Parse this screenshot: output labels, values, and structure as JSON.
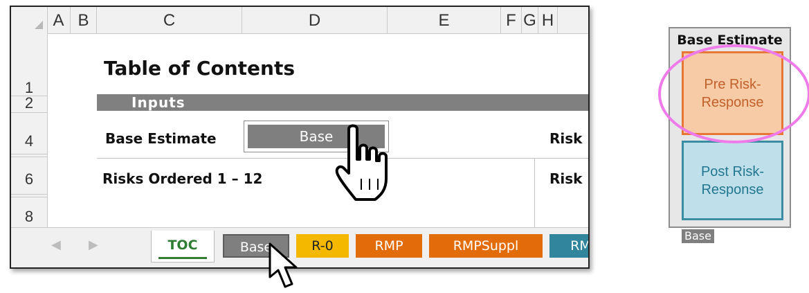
{
  "spreadsheet": {
    "columns": [
      "A",
      "B",
      "C",
      "D",
      "E",
      "F",
      "G",
      "H"
    ],
    "rows": [
      "1",
      "2",
      "4",
      "6",
      "8"
    ],
    "title": "Table of Contents",
    "section_header": "Inputs",
    "base_estimate_label": "Base Estimate",
    "base_button_label": "Base",
    "risk_label_1": "Risk",
    "risks_ordered_label": "Risks Ordered  1 – 12",
    "risk_label_2": "Risk"
  },
  "tabs": [
    {
      "label": "TOC",
      "color": "#ffffff",
      "active": true
    },
    {
      "label": "Base",
      "color": "#7f7f7f"
    },
    {
      "label": "R-0",
      "color": "#f5b800"
    },
    {
      "label": "RMP",
      "color": "#e36c0a"
    },
    {
      "label": "RMPSuppl",
      "color": "#e36c0a"
    },
    {
      "label": "RM",
      "color": "#31859c"
    }
  ],
  "diagram": {
    "title": "Base Estimate",
    "pre_box": "Pre Risk-\nResponse",
    "post_box": "Post Risk-\nResponse",
    "tag": "Base",
    "highlight_color": "#ee7be9"
  },
  "icons": [
    "hand-pointer-icon",
    "arrow-cursor-icon",
    "scroll-left-icon",
    "scroll-right-icon"
  ]
}
